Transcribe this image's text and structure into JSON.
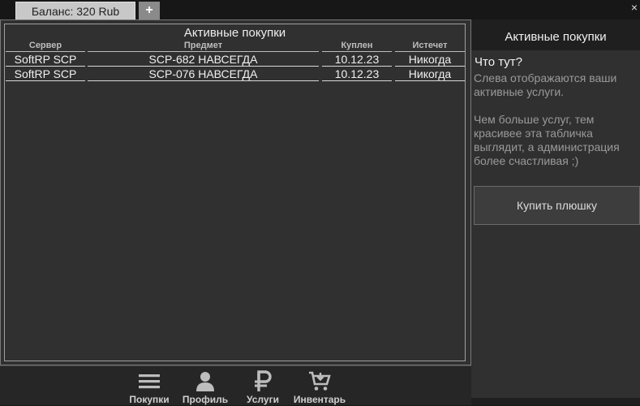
{
  "top": {
    "balance_tab": "Баланс: 320 Rub",
    "add_tab": "+",
    "close": "×"
  },
  "table": {
    "title": "Активные покупки",
    "columns": [
      "Сервер",
      "Предмет",
      "Куплен",
      "Истечет"
    ],
    "rows": [
      [
        "SoftRP SCP",
        "SCP-682 НАВСЕГДА",
        "10.12.23",
        "Никогда"
      ],
      [
        "SoftRP SCP",
        "SCP-076 НАВСЕГДА",
        "10.12.23",
        "Никогда"
      ]
    ]
  },
  "nav": {
    "items": [
      {
        "label": "Покупки",
        "icon": "list-icon"
      },
      {
        "label": "Профиль",
        "icon": "user-icon"
      },
      {
        "label": "Услуги",
        "icon": "ruble-icon"
      },
      {
        "label": "Инвентарь",
        "icon": "cart-icon"
      }
    ]
  },
  "side": {
    "header": "Активные покупки",
    "help_title": "Что тут?",
    "help_p1": "Слева отображаются ваши активные услуги.",
    "help_p2": "Чем больше услуг, тем красивее эта табличка выглядит, а администрация более счастливая ;)",
    "buy_button": "Купить плюшку"
  }
}
